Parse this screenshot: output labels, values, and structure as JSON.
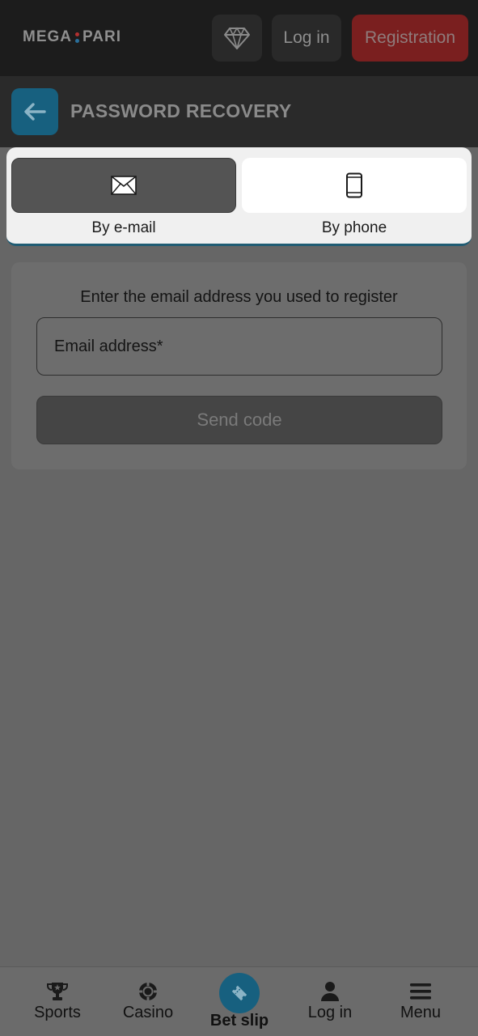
{
  "header": {
    "logo": {
      "left": "MEGA",
      "right": "PARI",
      "dot_colors": [
        "#b03030",
        "#2a6f9a"
      ]
    },
    "vip_icon": "diamond-icon",
    "login_label": "Log in",
    "register_label": "Registration"
  },
  "title_bar": {
    "back_icon": "arrow-left-icon",
    "title": "PASSWORD RECOVERY"
  },
  "recovery_methods": [
    {
      "label": "By e-mail",
      "icon": "envelope-icon",
      "selected": true
    },
    {
      "label": "By phone",
      "icon": "smartphone-icon",
      "selected": false
    }
  ],
  "form": {
    "hint": "Enter the email address you used to register",
    "email_placeholder": "Email address*",
    "submit_label": "Send code"
  },
  "bottom_nav": [
    {
      "label": "Sports",
      "icon": "trophy-icon"
    },
    {
      "label": "Casino",
      "icon": "casino-chip-icon"
    },
    {
      "label": "Bet slip",
      "icon": "ticket-icon"
    },
    {
      "label": "Log in",
      "icon": "user-icon"
    },
    {
      "label": "Menu",
      "icon": "hamburger-menu-icon"
    }
  ],
  "colors": {
    "accent_blue": "#17607f",
    "register_red": "#7a1f1f",
    "overlay_gray": "#666666"
  }
}
